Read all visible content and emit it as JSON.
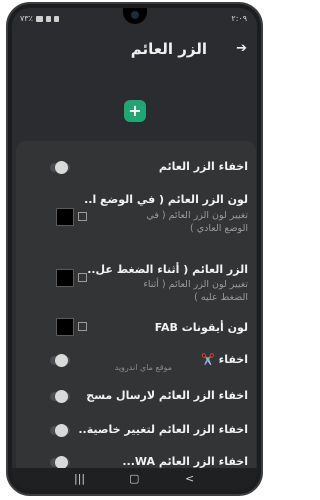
{
  "status": {
    "time": "٢:٠٩",
    "left_text": "٧٣٪"
  },
  "appbar": {
    "title": "الزر العائم",
    "back_icon": "arrow-right-icon"
  },
  "fab": {
    "symbol": "+"
  },
  "settings": {
    "hide_fab": {
      "title": "اخفاء الزر العائم"
    },
    "fab_color_normal": {
      "title": "لون الزر العائم ( في الوضع ا..",
      "summary": "تغيير لون الزر العائم ( في الوضع العادي )"
    },
    "fab_color_pressed": {
      "title": "الزر العائم ( أثناء الضغط عل..",
      "summary": "تغيير لون الزر العائم ( أثناء الضغط عليه )"
    },
    "fab_icons_color": {
      "title": "لون أيقونات FAB"
    },
    "hide_with_icon": {
      "title": "اخفاء ✂️"
    },
    "watermark": "موقع ماي اندرويد",
    "hide_fab_messages": {
      "title": "اخفاء الزر العائم لارسال مسج"
    },
    "hide_fab_feature": {
      "title": "اخفاء الزر العائم لتغيير خاصية.."
    },
    "hide_fab_wa": {
      "title": "اخفاء الزر العائم WA..."
    }
  }
}
